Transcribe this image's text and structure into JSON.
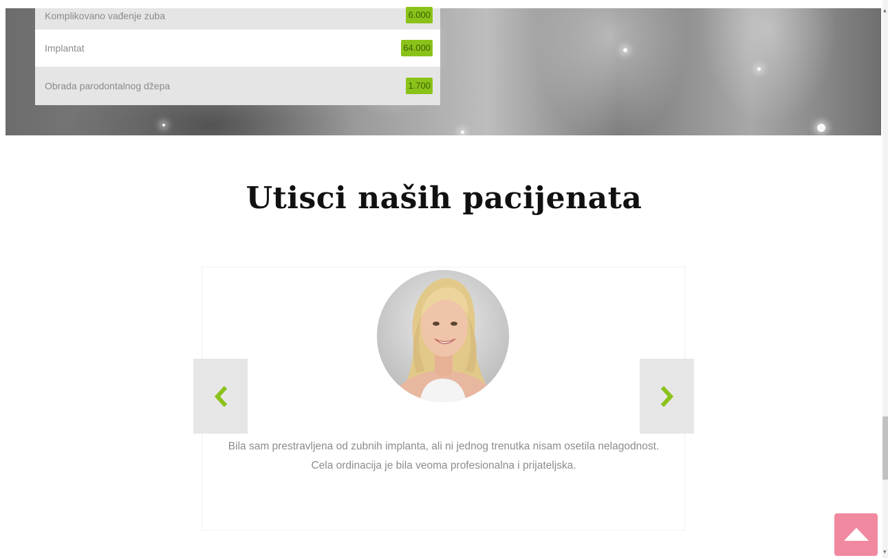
{
  "pricing": {
    "rows": [
      {
        "service": "Komplikovano vađenje zuba",
        "price": "6.000"
      },
      {
        "service": "Implantat",
        "price": "64.000"
      },
      {
        "service": "Obrada parodontalnog džepa",
        "price": "1.700"
      }
    ]
  },
  "testimonials": {
    "title": "Utisci naših pacijenata",
    "current": {
      "text": "Bila sam prestravljena od zubnih implanta, ali ni jednog trenutka nisam osetila nelagodnost. Cela ordinacija je bila veoma profesionalna i prijateljska.",
      "avatar_icon": "patient-photo"
    },
    "prev_icon": "chevron-left-icon",
    "next_icon": "chevron-right-icon"
  },
  "colors": {
    "accent": "#8bc21a",
    "back_to_top": "#f0899f"
  },
  "back_to_top_icon": "triangle-up-icon"
}
